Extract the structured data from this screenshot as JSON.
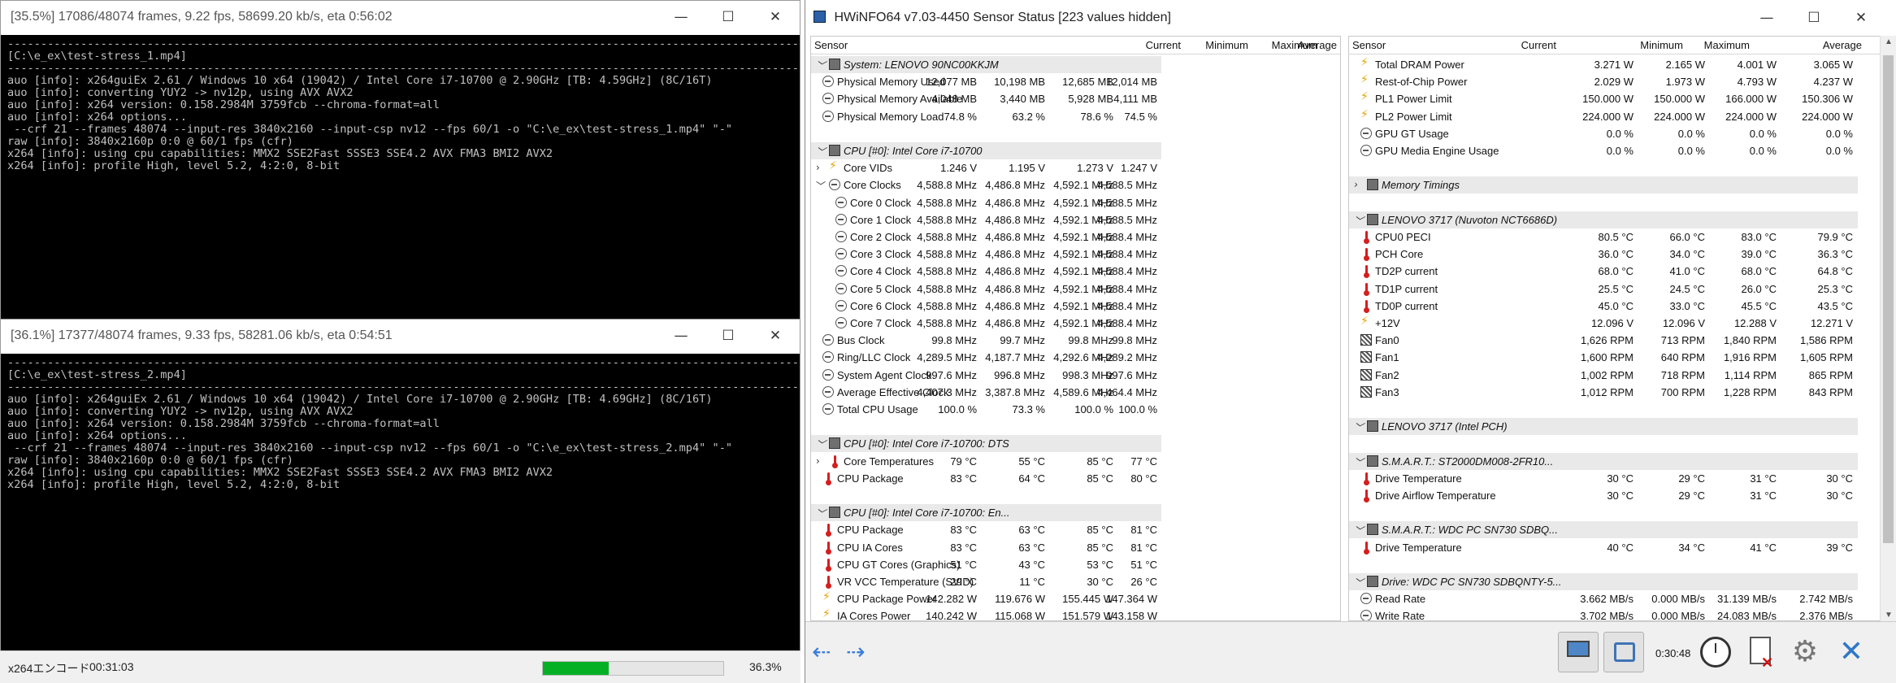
{
  "enc1": {
    "title": "[35.5%] 17086/48074 frames, 9.22 fps, 58699.20 kb/s, eta 0:56:02",
    "lines": [
      "-------------------------------------------------------------------------------------------------------------------------",
      "[C:\\e_ex\\test-stress_1.mp4]",
      "-------------------------------------------------------------------------------------------------------------------------",
      "auo [info]: x264guiEx 2.61 / Windows 10 x64 (19042) / Intel Core i7-10700 @ 2.90GHz [TB: 4.59GHz] (8C/16T)",
      "auo [info]: converting YUY2 -> nv12p, using AVX AVX2",
      "auo [info]: x264 version: 0.158.2984M 3759fcb --chroma-format=all",
      "auo [info]: x264 options...",
      " --crf 21 --frames 48074 --input-res 3840x2160 --input-csp nv12 --fps 60/1 -o \"C:\\e_ex\\test-stress_1.mp4\" \"-\"",
      "raw [info]: 3840x2160p 0:0 @ 60/1 fps (cfr)",
      "x264 [info]: using cpu capabilities: MMX2 SSE2Fast SSSE3 SSE4.2 AVX FMA3 BMI2 AVX2",
      "x264 [info]: profile High, level 5.2, 4:2:0, 8-bit"
    ]
  },
  "enc2": {
    "title": "[36.1%] 17377/48074 frames, 9.33 fps, 58281.06 kb/s, eta 0:54:51",
    "lines": [
      "-------------------------------------------------------------------------------------------------------------------------",
      "[C:\\e_ex\\test-stress_2.mp4]",
      "-------------------------------------------------------------------------------------------------------------------------",
      "auo [info]: x264guiEx 2.61 / Windows 10 x64 (19042) / Intel Core i7-10700 @ 2.90GHz [TB: 4.69GHz] (8C/16T)",
      "auo [info]: converting YUY2 -> nv12p, using AVX AVX2",
      "auo [info]: x264 version: 0.158.2984M 3759fcb --chroma-format=all",
      "auo [info]: x264 options...",
      " --crf 21 --frames 48074 --input-res 3840x2160 --input-csp nv12 --fps 60/1 -o \"C:\\e_ex\\test-stress_2.mp4\" \"-\"",
      "raw [info]: 3840x2160p 0:0 @ 60/1 fps (cfr)",
      "x264 [info]: using cpu capabilities: MMX2 SSE2Fast SSSE3 SSE4.2 AVX FMA3 BMI2 AVX2",
      "x264 [info]: profile High, level 5.2, 4:2:0, 8-bit"
    ]
  },
  "statusbar": {
    "label": "x264エンコード",
    "elapsed": "00:31:03",
    "percent": "36.3%",
    "progress": 0.363
  },
  "hw": {
    "title": "HWiNFO64 v7.03-4450 Sensor Status [223 values hidden]",
    "columns": [
      "Sensor",
      "Current",
      "Minimum",
      "Maximum",
      "Average"
    ],
    "left": [
      {
        "kind": "grp",
        "exp": "﹀",
        "icon": "chip",
        "name": "System: LENOVO 90NC00KKJM"
      },
      {
        "indent": 1,
        "icon": "mem",
        "name": "Physical Memory Used",
        "v": [
          "12,077 MB",
          "10,198 MB",
          "12,685 MB",
          "12,014 MB"
        ]
      },
      {
        "indent": 1,
        "icon": "mem",
        "name": "Physical Memory Available",
        "v": [
          "4,048 MB",
          "3,440 MB",
          "5,928 MB",
          "4,111 MB"
        ]
      },
      {
        "indent": 1,
        "icon": "mem",
        "name": "Physical Memory Load",
        "v": [
          "74.8 %",
          "63.2 %",
          "78.6 %",
          "74.5 %"
        ]
      },
      {
        "kind": "blank"
      },
      {
        "kind": "grp",
        "exp": "﹀",
        "icon": "chip",
        "name": "CPU [#0]: Intel Core i7-10700"
      },
      {
        "indent": 2,
        "exp": "›",
        "icon": "bolt",
        "name": "Core VIDs",
        "v": [
          "1.246 V",
          "1.195 V",
          "1.273 V",
          "1.247 V"
        ]
      },
      {
        "indent": 2,
        "exp": "﹀",
        "icon": "mem",
        "name": "Core Clocks",
        "v": [
          "4,588.8 MHz",
          "4,486.8 MHz",
          "4,592.1 MHz",
          "4,588.5 MHz"
        ]
      },
      {
        "indent": 3,
        "icon": "mem",
        "name": "Core 0 Clock",
        "v": [
          "4,588.8 MHz",
          "4,486.8 MHz",
          "4,592.1 MHz",
          "4,588.5 MHz"
        ]
      },
      {
        "indent": 3,
        "icon": "mem",
        "name": "Core 1 Clock",
        "v": [
          "4,588.8 MHz",
          "4,486.8 MHz",
          "4,592.1 MHz",
          "4,588.5 MHz"
        ]
      },
      {
        "indent": 3,
        "icon": "mem",
        "name": "Core 2 Clock",
        "v": [
          "4,588.8 MHz",
          "4,486.8 MHz",
          "4,592.1 MHz",
          "4,588.4 MHz"
        ]
      },
      {
        "indent": 3,
        "icon": "mem",
        "name": "Core 3 Clock",
        "v": [
          "4,588.8 MHz",
          "4,486.8 MHz",
          "4,592.1 MHz",
          "4,588.4 MHz"
        ]
      },
      {
        "indent": 3,
        "icon": "mem",
        "name": "Core 4 Clock",
        "v": [
          "4,588.8 MHz",
          "4,486.8 MHz",
          "4,592.1 MHz",
          "4,588.4 MHz"
        ]
      },
      {
        "indent": 3,
        "icon": "mem",
        "name": "Core 5 Clock",
        "v": [
          "4,588.8 MHz",
          "4,486.8 MHz",
          "4,592.1 MHz",
          "4,588.4 MHz"
        ]
      },
      {
        "indent": 3,
        "icon": "mem",
        "name": "Core 6 Clock",
        "v": [
          "4,588.8 MHz",
          "4,486.8 MHz",
          "4,592.1 MHz",
          "4,588.4 MHz"
        ]
      },
      {
        "indent": 3,
        "icon": "mem",
        "name": "Core 7 Clock",
        "v": [
          "4,588.8 MHz",
          "4,486.8 MHz",
          "4,592.1 MHz",
          "4,588.4 MHz"
        ]
      },
      {
        "indent": 1,
        "icon": "mem",
        "name": "Bus Clock",
        "v": [
          "99.8 MHz",
          "99.7 MHz",
          "99.8 MHz",
          "99.8 MHz"
        ]
      },
      {
        "indent": 1,
        "icon": "mem",
        "name": "Ring/LLC Clock",
        "v": [
          "4,289.5 MHz",
          "4,187.7 MHz",
          "4,292.6 MHz",
          "4,289.2 MHz"
        ]
      },
      {
        "indent": 1,
        "icon": "mem",
        "name": "System Agent Clock",
        "v": [
          "997.6 MHz",
          "996.8 MHz",
          "998.3 MHz",
          "997.6 MHz"
        ]
      },
      {
        "indent": 1,
        "icon": "mem",
        "name": "Average Effective Clock",
        "v": [
          "4,407.3 MHz",
          "3,387.8 MHz",
          "4,589.6 MHz",
          "4,464.4 MHz"
        ]
      },
      {
        "indent": 1,
        "icon": "mem",
        "name": "Total CPU Usage",
        "v": [
          "100.0 %",
          "73.3 %",
          "100.0 %",
          "100.0 %"
        ]
      },
      {
        "kind": "blank"
      },
      {
        "kind": "grp",
        "exp": "﹀",
        "icon": "chip",
        "name": "CPU [#0]: Intel Core i7-10700: DTS"
      },
      {
        "indent": 2,
        "exp": "›",
        "icon": "therm",
        "name": "Core Temperatures",
        "v": [
          "79 °C",
          "55 °C",
          "85 °C",
          "77 °C"
        ]
      },
      {
        "indent": 1,
        "icon": "therm",
        "name": "CPU Package",
        "v": [
          "83 °C",
          "64 °C",
          "85 °C",
          "80 °C"
        ]
      },
      {
        "kind": "blank"
      },
      {
        "kind": "grp",
        "exp": "﹀",
        "icon": "chip",
        "name": "CPU [#0]: Intel Core i7-10700: En..."
      },
      {
        "indent": 1,
        "icon": "therm",
        "name": "CPU Package",
        "v": [
          "83 °C",
          "63 °C",
          "85 °C",
          "81 °C"
        ]
      },
      {
        "indent": 1,
        "icon": "therm",
        "name": "CPU IA Cores",
        "v": [
          "83 °C",
          "63 °C",
          "85 °C",
          "81 °C"
        ]
      },
      {
        "indent": 1,
        "icon": "therm",
        "name": "CPU GT Cores (Graphics)",
        "v": [
          "51 °C",
          "43 °C",
          "53 °C",
          "51 °C"
        ]
      },
      {
        "indent": 1,
        "icon": "therm",
        "name": "VR VCC Temperature (SVID)",
        "v": [
          "29 °C",
          "11 °C",
          "30 °C",
          "26 °C"
        ]
      },
      {
        "indent": 1,
        "icon": "bolt",
        "name": "CPU Package Power",
        "v": [
          "142.282 W",
          "119.676 W",
          "155.445 W",
          "147.364 W"
        ]
      },
      {
        "indent": 1,
        "icon": "bolt",
        "name": "IA Cores Power",
        "v": [
          "140.242 W",
          "115.068 W",
          "151.579 W",
          "143.158 W"
        ]
      }
    ],
    "right": [
      {
        "indent": 1,
        "icon": "bolt",
        "name": "Total DRAM Power",
        "v": [
          "3.271 W",
          "2.165 W",
          "4.001 W",
          "3.065 W"
        ]
      },
      {
        "indent": 1,
        "icon": "bolt",
        "name": "Rest-of-Chip Power",
        "v": [
          "2.029 W",
          "1.973 W",
          "4.793 W",
          "4.237 W"
        ]
      },
      {
        "indent": 1,
        "icon": "bolt",
        "name": "PL1 Power Limit",
        "v": [
          "150.000 W",
          "150.000 W",
          "166.000 W",
          "150.306 W"
        ]
      },
      {
        "indent": 1,
        "icon": "bolt",
        "name": "PL2 Power Limit",
        "v": [
          "224.000 W",
          "224.000 W",
          "224.000 W",
          "224.000 W"
        ]
      },
      {
        "indent": 1,
        "icon": "mem",
        "name": "GPU GT Usage",
        "v": [
          "0.0 %",
          "0.0 %",
          "0.0 %",
          "0.0 %"
        ]
      },
      {
        "indent": 1,
        "icon": "mem",
        "name": "GPU Media Engine Usage",
        "v": [
          "0.0 %",
          "0.0 %",
          "0.0 %",
          "0.0 %"
        ]
      },
      {
        "kind": "blank"
      },
      {
        "kind": "grp",
        "exp": "›",
        "icon": "chip",
        "name": "Memory Timings"
      },
      {
        "kind": "blank"
      },
      {
        "kind": "grp",
        "exp": "﹀",
        "icon": "chip",
        "name": "LENOVO 3717 (Nuvoton NCT6686D)"
      },
      {
        "indent": 1,
        "icon": "therm",
        "name": "CPU0 PECI",
        "v": [
          "80.5 °C",
          "66.0 °C",
          "83.0 °C",
          "79.9 °C"
        ]
      },
      {
        "indent": 1,
        "icon": "therm",
        "name": "PCH Core",
        "v": [
          "36.0 °C",
          "34.0 °C",
          "39.0 °C",
          "36.3 °C"
        ]
      },
      {
        "indent": 1,
        "icon": "therm",
        "name": "TD2P current",
        "v": [
          "68.0 °C",
          "41.0 °C",
          "68.0 °C",
          "64.8 °C"
        ]
      },
      {
        "indent": 1,
        "icon": "therm",
        "name": "TD1P current",
        "v": [
          "25.5 °C",
          "24.5 °C",
          "26.0 °C",
          "25.3 °C"
        ]
      },
      {
        "indent": 1,
        "icon": "therm",
        "name": "TD0P current",
        "v": [
          "45.0 °C",
          "33.0 °C",
          "45.5 °C",
          "43.5 °C"
        ]
      },
      {
        "indent": 1,
        "icon": "bolt",
        "name": "+12V",
        "v": [
          "12.096 V",
          "12.096 V",
          "12.288 V",
          "12.271 V"
        ]
      },
      {
        "indent": 1,
        "icon": "fan",
        "name": "Fan0",
        "v": [
          "1,626 RPM",
          "713 RPM",
          "1,840 RPM",
          "1,586 RPM"
        ]
      },
      {
        "indent": 1,
        "icon": "fan",
        "name": "Fan1",
        "v": [
          "1,600 RPM",
          "640 RPM",
          "1,916 RPM",
          "1,605 RPM"
        ]
      },
      {
        "indent": 1,
        "icon": "fan",
        "name": "Fan2",
        "v": [
          "1,002 RPM",
          "718 RPM",
          "1,114 RPM",
          "865 RPM"
        ]
      },
      {
        "indent": 1,
        "icon": "fan",
        "name": "Fan3",
        "v": [
          "1,012 RPM",
          "700 RPM",
          "1,228 RPM",
          "843 RPM"
        ]
      },
      {
        "kind": "blank"
      },
      {
        "kind": "grp",
        "exp": "﹀",
        "icon": "chip",
        "name": "LENOVO 3717 (Intel PCH)"
      },
      {
        "kind": "blank"
      },
      {
        "kind": "grp",
        "exp": "﹀",
        "icon": "chip",
        "name": "S.M.A.R.T.: ST2000DM008-2FR10..."
      },
      {
        "indent": 1,
        "icon": "therm",
        "name": "Drive Temperature",
        "v": [
          "30 °C",
          "29 °C",
          "31 °C",
          "30 °C"
        ]
      },
      {
        "indent": 1,
        "icon": "therm",
        "name": "Drive Airflow Temperature",
        "v": [
          "30 °C",
          "29 °C",
          "31 °C",
          "30 °C"
        ]
      },
      {
        "kind": "blank"
      },
      {
        "kind": "grp",
        "exp": "﹀",
        "icon": "chip",
        "name": "S.M.A.R.T.: WDC PC SN730 SDBQ..."
      },
      {
        "indent": 1,
        "icon": "therm",
        "name": "Drive Temperature",
        "v": [
          "40 °C",
          "34 °C",
          "41 °C",
          "39 °C"
        ]
      },
      {
        "kind": "blank"
      },
      {
        "kind": "grp",
        "exp": "﹀",
        "icon": "chip",
        "name": "Drive: WDC PC SN730 SDBQNTY-5..."
      },
      {
        "indent": 1,
        "icon": "mem",
        "name": "Read Rate",
        "v": [
          "3.662 MB/s",
          "0.000 MB/s",
          "31.139 MB/s",
          "2.742 MB/s"
        ]
      },
      {
        "indent": 1,
        "icon": "mem",
        "name": "Write Rate",
        "v": [
          "3.702 MB/s",
          "0.000 MB/s",
          "24.083 MB/s",
          "2.376 MB/s"
        ]
      }
    ],
    "timer": "0:30:48"
  }
}
